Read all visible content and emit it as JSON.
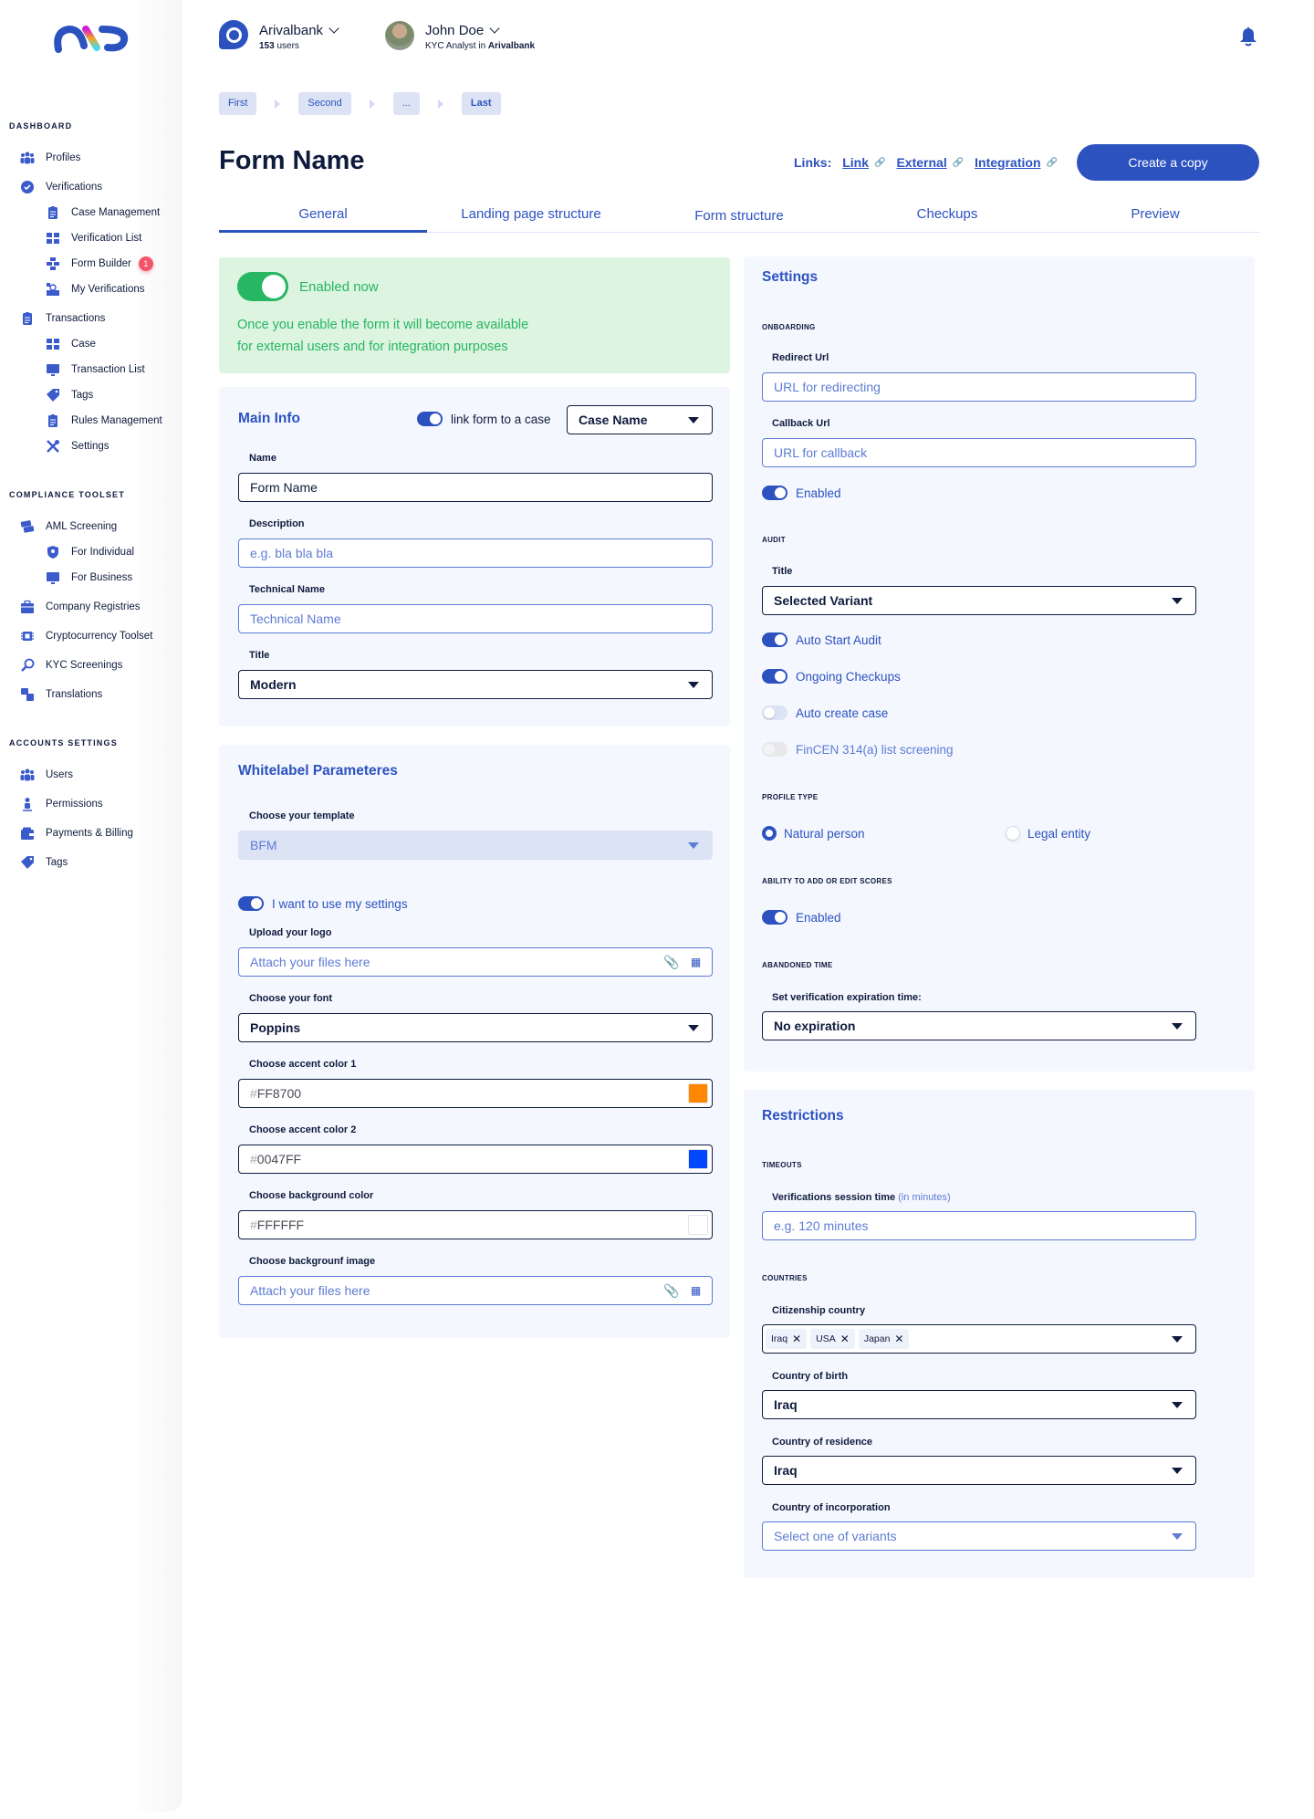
{
  "sidebar": {
    "sections": [
      {
        "title": "DASHBOARD"
      },
      {
        "title": "COMPLIANCE TOOLSET"
      },
      {
        "title": "ACCOUNTS SETTINGS"
      }
    ],
    "items": [
      {
        "label": "Profiles",
        "icon": "users-icon"
      },
      {
        "label": "Verifications",
        "icon": "verified-badge-icon"
      },
      {
        "label": "Case Management",
        "icon": "clipboard-icon"
      },
      {
        "label": "Verification List",
        "icon": "checklist-icon"
      },
      {
        "label": "Form Builder",
        "icon": "bricks-icon",
        "badge": "1"
      },
      {
        "label": "My Verifications",
        "icon": "user-verify-icon"
      },
      {
        "label": "Transactions",
        "icon": "clipboard-icon"
      },
      {
        "label": "Case",
        "icon": "checklist-icon"
      },
      {
        "label": "Transaction List",
        "icon": "monitor-icon"
      },
      {
        "label": "Tags",
        "icon": "tag-icon"
      },
      {
        "label": "Rules Management",
        "icon": "clipboard-icon"
      },
      {
        "label": "Settings",
        "icon": "tools-icon"
      },
      {
        "label": "AML Screening",
        "icon": "money-icon"
      },
      {
        "label": "For Individual",
        "icon": "shield-icon"
      },
      {
        "label": "For Business",
        "icon": "monitor-icon"
      },
      {
        "label": "Company Registries",
        "icon": "briefcase-icon"
      },
      {
        "label": "Cryptocurrency Toolset",
        "icon": "chip-icon"
      },
      {
        "label": "KYC Screenings",
        "icon": "search-user-icon"
      },
      {
        "label": "Translations",
        "icon": "translate-icon"
      },
      {
        "label": "Users",
        "icon": "users-icon"
      },
      {
        "label": "Permissions",
        "icon": "person-key-icon"
      },
      {
        "label": "Payments & Billing",
        "icon": "wallet-icon"
      },
      {
        "label": "Tags",
        "icon": "tag-icon"
      }
    ]
  },
  "header": {
    "org_name": "Arivalbank",
    "org_users_count": "153",
    "org_users_suffix": " users",
    "user_name": "John Doe",
    "user_role": "KYC Analyst in ",
    "user_org": "Arivalbank"
  },
  "breadcrumbs": [
    "First",
    "Second",
    "...",
    "Last"
  ],
  "page": {
    "title": "Form Name",
    "links_label": "Links:",
    "links": [
      "Link",
      "External",
      "Integration"
    ],
    "copy_button": "Create a copy"
  },
  "tabs": [
    {
      "label": "General",
      "active": true
    },
    {
      "label": "Landing page structure"
    },
    {
      "label": "Form structure"
    },
    {
      "label": "Checkups"
    },
    {
      "label": "Preview"
    }
  ],
  "status_card": {
    "toggle_label": "Enabled now",
    "enabled": true,
    "description_line1": "Once you enable the form it will become available",
    "description_line2": "for external users and for integration purposes"
  },
  "main_info": {
    "title": "Main Info",
    "link_case_label": "link form to a case",
    "link_case_enabled": true,
    "case_select": "Case Name",
    "name_label": "Name",
    "name_value": "Form Name",
    "description_label": "Description",
    "description_placeholder": "e.g. bla bla bla",
    "technical_label": "Technical Name",
    "technical_placeholder": "Technical Name",
    "title_label": "Title",
    "title_value": "Modern"
  },
  "whitelabel": {
    "title": "Whitelabel Parameteres",
    "template_label": "Choose your template",
    "template_value": "BFM",
    "own_settings_label": "I want to use my settings",
    "own_settings_enabled": true,
    "logo_label": "Upload your logo",
    "logo_placeholder": "Attach your files here",
    "font_label": "Choose your font",
    "font_value": "Poppins",
    "accent1_label": "Choose accent color 1",
    "accent1_value": "FF8700",
    "accent1_color": "#FF8700",
    "accent2_label": "Choose accent color 2",
    "accent2_value": "0047FF",
    "accent2_color": "#0047FF",
    "bg_color_label": "Choose background color",
    "bg_color_value": "FFFFFF",
    "bg_color": "#FFFFFF",
    "bg_image_label": "Choose backgrounf image",
    "bg_image_placeholder": "Attach your files here",
    "hash": "#"
  },
  "settings": {
    "title": "Settings",
    "onboarding_caption": "ONBOARDING",
    "redirect_label": "Redirect Url",
    "redirect_placeholder": "URL for redirecting",
    "callback_label": "Callback Url",
    "callback_placeholder": "URL for callback",
    "callback_enabled_label": "Enabled",
    "audit_caption": "AUDIT",
    "audit_title_label": "Title",
    "audit_title_value": "Selected Variant",
    "toggles": [
      {
        "label": "Auto Start Audit",
        "state": "on"
      },
      {
        "label": "Ongoing Checkups",
        "state": "on"
      },
      {
        "label": "Auto create case",
        "state": "off"
      },
      {
        "label": "FinCEN 314(a) list screening",
        "state": "disabled"
      }
    ],
    "profile_type_caption": "PROFILE TYPE",
    "profile_types": [
      {
        "label": "Natural person",
        "selected": true
      },
      {
        "label": "Legal entity",
        "selected": false
      }
    ],
    "scores_caption": "ABILITY TO ADD OR EDIT SCORES",
    "scores_enabled_label": "Enabled",
    "abandoned_caption": "ABANDONED TIME",
    "expiration_label": "Set verification expiration time:",
    "expiration_value": "No expiration"
  },
  "restrictions": {
    "title": "Restrictions",
    "timeouts_caption": "TIMEOUTS",
    "session_label": "Verifications session time",
    "session_hint": "(in minutes)",
    "session_placeholder": "e.g. 120 minutes",
    "countries_caption": "COUNTRIES",
    "citizenship_label": "Citizenship country",
    "citizenship_values": [
      "Iraq",
      "USA",
      "Japan"
    ],
    "birth_label": "Country of birth",
    "birth_value": "Iraq",
    "residence_label": "Country of residence",
    "residence_value": "Iraq",
    "incorporation_label": "Country of incorporation",
    "incorporation_placeholder": "Select one of variants"
  },
  "colors": {
    "primary": "#2C52C0",
    "success": "#27B661",
    "badge": "#F2546B"
  }
}
